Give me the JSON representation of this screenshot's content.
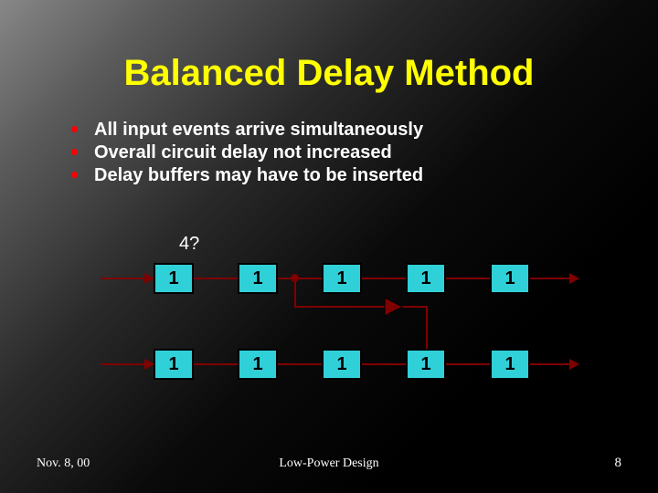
{
  "title": "Balanced Delay Method",
  "bullets": [
    "All input events arrive simultaneously",
    "Overall circuit delay not increased",
    "Delay buffers may have to be inserted"
  ],
  "annotation": "4?",
  "rows": {
    "top": [
      "1",
      "1",
      "1",
      "1",
      "1"
    ],
    "bottom": [
      "1",
      "1",
      "1",
      "1",
      "1"
    ]
  },
  "footer": {
    "date": "Nov. 8, 00",
    "center": "Low-Power Design",
    "page": "8"
  }
}
